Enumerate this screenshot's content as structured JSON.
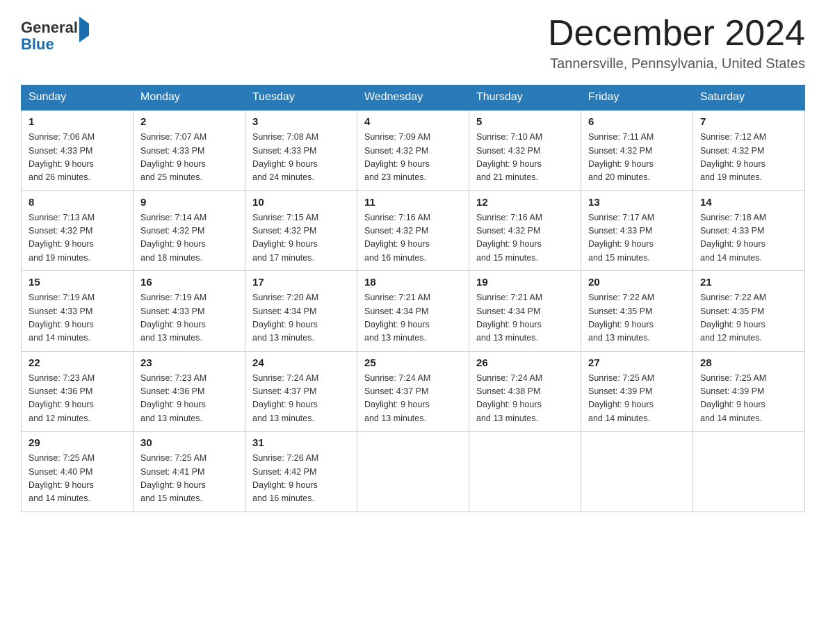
{
  "header": {
    "logo_general": "General",
    "logo_blue": "Blue",
    "month": "December 2024",
    "location": "Tannersville, Pennsylvania, United States"
  },
  "days_of_week": [
    "Sunday",
    "Monday",
    "Tuesday",
    "Wednesday",
    "Thursday",
    "Friday",
    "Saturday"
  ],
  "weeks": [
    [
      {
        "day": "1",
        "sunrise": "7:06 AM",
        "sunset": "4:33 PM",
        "daylight": "9 hours and 26 minutes."
      },
      {
        "day": "2",
        "sunrise": "7:07 AM",
        "sunset": "4:33 PM",
        "daylight": "9 hours and 25 minutes."
      },
      {
        "day": "3",
        "sunrise": "7:08 AM",
        "sunset": "4:33 PM",
        "daylight": "9 hours and 24 minutes."
      },
      {
        "day": "4",
        "sunrise": "7:09 AM",
        "sunset": "4:32 PM",
        "daylight": "9 hours and 23 minutes."
      },
      {
        "day": "5",
        "sunrise": "7:10 AM",
        "sunset": "4:32 PM",
        "daylight": "9 hours and 21 minutes."
      },
      {
        "day": "6",
        "sunrise": "7:11 AM",
        "sunset": "4:32 PM",
        "daylight": "9 hours and 20 minutes."
      },
      {
        "day": "7",
        "sunrise": "7:12 AM",
        "sunset": "4:32 PM",
        "daylight": "9 hours and 19 minutes."
      }
    ],
    [
      {
        "day": "8",
        "sunrise": "7:13 AM",
        "sunset": "4:32 PM",
        "daylight": "9 hours and 19 minutes."
      },
      {
        "day": "9",
        "sunrise": "7:14 AM",
        "sunset": "4:32 PM",
        "daylight": "9 hours and 18 minutes."
      },
      {
        "day": "10",
        "sunrise": "7:15 AM",
        "sunset": "4:32 PM",
        "daylight": "9 hours and 17 minutes."
      },
      {
        "day": "11",
        "sunrise": "7:16 AM",
        "sunset": "4:32 PM",
        "daylight": "9 hours and 16 minutes."
      },
      {
        "day": "12",
        "sunrise": "7:16 AM",
        "sunset": "4:32 PM",
        "daylight": "9 hours and 15 minutes."
      },
      {
        "day": "13",
        "sunrise": "7:17 AM",
        "sunset": "4:33 PM",
        "daylight": "9 hours and 15 minutes."
      },
      {
        "day": "14",
        "sunrise": "7:18 AM",
        "sunset": "4:33 PM",
        "daylight": "9 hours and 14 minutes."
      }
    ],
    [
      {
        "day": "15",
        "sunrise": "7:19 AM",
        "sunset": "4:33 PM",
        "daylight": "9 hours and 14 minutes."
      },
      {
        "day": "16",
        "sunrise": "7:19 AM",
        "sunset": "4:33 PM",
        "daylight": "9 hours and 13 minutes."
      },
      {
        "day": "17",
        "sunrise": "7:20 AM",
        "sunset": "4:34 PM",
        "daylight": "9 hours and 13 minutes."
      },
      {
        "day": "18",
        "sunrise": "7:21 AM",
        "sunset": "4:34 PM",
        "daylight": "9 hours and 13 minutes."
      },
      {
        "day": "19",
        "sunrise": "7:21 AM",
        "sunset": "4:34 PM",
        "daylight": "9 hours and 13 minutes."
      },
      {
        "day": "20",
        "sunrise": "7:22 AM",
        "sunset": "4:35 PM",
        "daylight": "9 hours and 13 minutes."
      },
      {
        "day": "21",
        "sunrise": "7:22 AM",
        "sunset": "4:35 PM",
        "daylight": "9 hours and 12 minutes."
      }
    ],
    [
      {
        "day": "22",
        "sunrise": "7:23 AM",
        "sunset": "4:36 PM",
        "daylight": "9 hours and 12 minutes."
      },
      {
        "day": "23",
        "sunrise": "7:23 AM",
        "sunset": "4:36 PM",
        "daylight": "9 hours and 13 minutes."
      },
      {
        "day": "24",
        "sunrise": "7:24 AM",
        "sunset": "4:37 PM",
        "daylight": "9 hours and 13 minutes."
      },
      {
        "day": "25",
        "sunrise": "7:24 AM",
        "sunset": "4:37 PM",
        "daylight": "9 hours and 13 minutes."
      },
      {
        "day": "26",
        "sunrise": "7:24 AM",
        "sunset": "4:38 PM",
        "daylight": "9 hours and 13 minutes."
      },
      {
        "day": "27",
        "sunrise": "7:25 AM",
        "sunset": "4:39 PM",
        "daylight": "9 hours and 14 minutes."
      },
      {
        "day": "28",
        "sunrise": "7:25 AM",
        "sunset": "4:39 PM",
        "daylight": "9 hours and 14 minutes."
      }
    ],
    [
      {
        "day": "29",
        "sunrise": "7:25 AM",
        "sunset": "4:40 PM",
        "daylight": "9 hours and 14 minutes."
      },
      {
        "day": "30",
        "sunrise": "7:25 AM",
        "sunset": "4:41 PM",
        "daylight": "9 hours and 15 minutes."
      },
      {
        "day": "31",
        "sunrise": "7:26 AM",
        "sunset": "4:42 PM",
        "daylight": "9 hours and 16 minutes."
      },
      null,
      null,
      null,
      null
    ]
  ]
}
